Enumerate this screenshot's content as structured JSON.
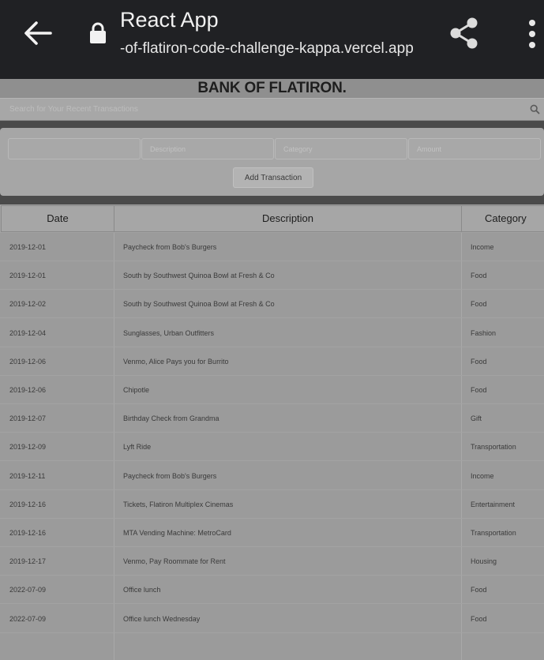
{
  "browser": {
    "tab_title": "React App",
    "url": "-of-flatiron-code-challenge-kappa.vercel.app",
    "icons": [
      "back-arrow-icon",
      "lock-icon",
      "share-icon",
      "more-vert-icon"
    ]
  },
  "app": {
    "title": "BANK OF FLATIRON.",
    "search_placeholder": "Search for Your Recent Transactions",
    "form": {
      "date_value": "",
      "description_placeholder": "Description",
      "category_placeholder": "Category",
      "amount_placeholder": "Amount",
      "add_label": "Add Transaction"
    },
    "table": {
      "columns": [
        "Date",
        "Description",
        "Category"
      ],
      "rows": [
        {
          "date": "2019-12-01",
          "description": "Paycheck from Bob's Burgers",
          "category": "Income"
        },
        {
          "date": "2019-12-01",
          "description": "South by Southwest Quinoa Bowl at Fresh & Co",
          "category": "Food"
        },
        {
          "date": "2019-12-02",
          "description": "South by Southwest Quinoa Bowl at Fresh & Co",
          "category": "Food"
        },
        {
          "date": "2019-12-04",
          "description": "Sunglasses, Urban Outfitters",
          "category": "Fashion"
        },
        {
          "date": "2019-12-06",
          "description": "Venmo, Alice Pays you for Burrito",
          "category": "Food"
        },
        {
          "date": "2019-12-06",
          "description": "Chipotle",
          "category": "Food"
        },
        {
          "date": "2019-12-07",
          "description": "Birthday Check from Grandma",
          "category": "Gift"
        },
        {
          "date": "2019-12-09",
          "description": "Lyft Ride",
          "category": "Transportation"
        },
        {
          "date": "2019-12-11",
          "description": "Paycheck from Bob's Burgers",
          "category": "Income"
        },
        {
          "date": "2019-12-16",
          "description": "Tickets, Flatiron Multiplex Cinemas",
          "category": "Entertainment"
        },
        {
          "date": "2019-12-16",
          "description": "MTA Vending Machine: MetroCard",
          "category": "Transportation"
        },
        {
          "date": "2019-12-17",
          "description": "Venmo, Pay Roommate for Rent",
          "category": "Housing"
        },
        {
          "date": "2022-07-09",
          "description": "Office lunch",
          "category": "Food"
        },
        {
          "date": "2022-07-09",
          "description": "Office lunch Wednesday",
          "category": "Food"
        }
      ]
    }
  }
}
